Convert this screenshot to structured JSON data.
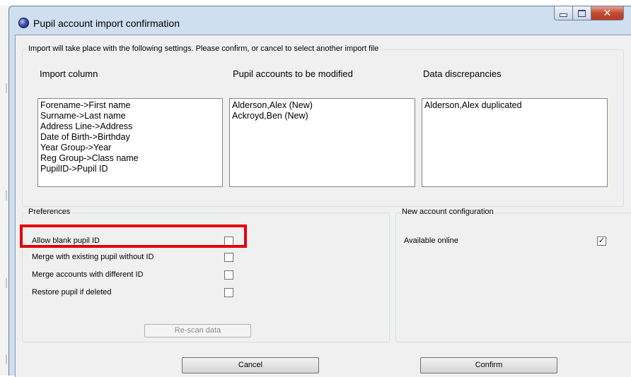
{
  "window": {
    "title": "Pupil account import confirmation"
  },
  "import_group": {
    "caption": "Import will take place with the following settings. Please confirm, or cancel to select another import file",
    "columns": [
      {
        "header": "Import column",
        "items": [
          "Forename->First name",
          "Surname->Last name",
          "Address Line->Address",
          "Date of Birth->Birthday",
          "Year Group->Year",
          "Reg Group->Class name",
          "PupilID->Pupil ID"
        ]
      },
      {
        "header": "Pupil accounts to be modified",
        "items": [
          "Alderson,Alex (New)",
          "Ackroyd,Ben (New)"
        ]
      },
      {
        "header": "Data discrepancies",
        "items": [
          "Alderson,Alex duplicated"
        ]
      }
    ]
  },
  "preferences": {
    "caption": "Preferences",
    "options": [
      {
        "label": "Allow blank pupil ID",
        "checked": false
      },
      {
        "label": "Merge with existing pupil without ID",
        "checked": false
      },
      {
        "label": "Merge accounts with different ID",
        "checked": false
      },
      {
        "label": "Restore pupil if deleted",
        "checked": false
      }
    ],
    "rescan_label": "Re-scan data"
  },
  "new_account": {
    "caption": "New account configuration",
    "option": {
      "label": "Available online",
      "checked": true
    }
  },
  "buttons": {
    "cancel": "Cancel",
    "confirm": "Confirm"
  },
  "highlight_color": "#e3000b"
}
